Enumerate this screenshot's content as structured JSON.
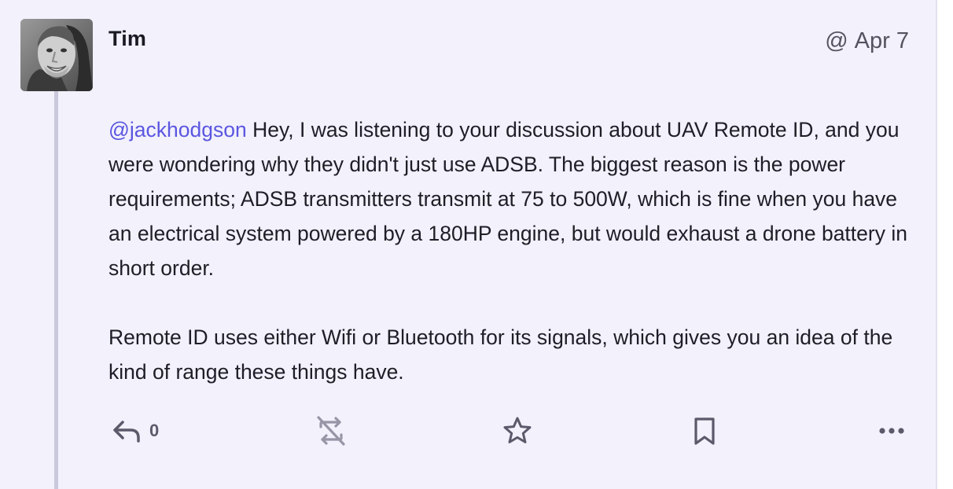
{
  "post": {
    "author": {
      "display_name": "Tim"
    },
    "visibility_icon": "at-icon",
    "visibility_symbol": "@",
    "date": "Apr 7",
    "mention": "@jackhodgson",
    "paragraph_1": " Hey, I was listening to your discussion about UAV Remote ID, and you were wondering why they didn't just use ADSB. The biggest reason is the power requirements; ADSB transmitters transmit at 75 to 500W, which is fine when you have an electrical system powered by a 180HP engine, but would exhaust a drone battery in short order.",
    "paragraph_2": "Remote ID uses either Wifi or Bluetooth for its signals, which gives you an idea of the kind of range these things have."
  },
  "actions": {
    "reply_icon": "reply-icon",
    "reply_count": "0",
    "boost_icon": "boost-disabled-icon",
    "favourite_icon": "star-icon",
    "bookmark_icon": "bookmark-icon",
    "more_icon": "ellipsis-icon"
  },
  "colors": {
    "background": "#f2f1fc",
    "mention": "#5b56e0",
    "text": "#1e1e26",
    "muted": "#5c5a6a",
    "thread_line": "#c9c8dc"
  }
}
